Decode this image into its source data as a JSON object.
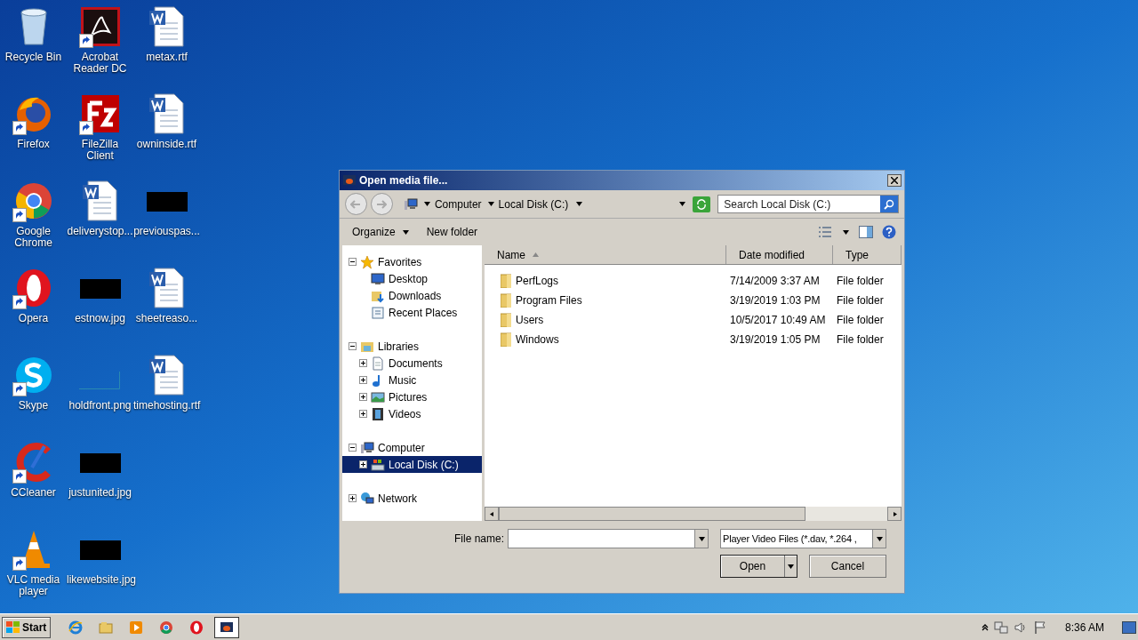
{
  "desktop": {
    "columns": [
      [
        {
          "label": "Recycle Bin",
          "kind": "recycle",
          "shortcut": false
        },
        {
          "label": "Firefox",
          "kind": "firefox",
          "shortcut": true
        },
        {
          "label": "Google Chrome",
          "kind": "chrome",
          "shortcut": true
        },
        {
          "label": "Opera",
          "kind": "opera",
          "shortcut": true
        },
        {
          "label": "Skype",
          "kind": "skype",
          "shortcut": true
        },
        {
          "label": "CCleaner",
          "kind": "ccleaner",
          "shortcut": true
        },
        {
          "label": "VLC media player",
          "kind": "vlc",
          "shortcut": true
        }
      ],
      [
        {
          "label": "Acrobat Reader DC",
          "kind": "acrobat",
          "shortcut": true
        },
        {
          "label": "FileZilla Client",
          "kind": "filezilla",
          "shortcut": true
        },
        {
          "label": "deliverystop...",
          "kind": "word",
          "shortcut": false
        },
        {
          "label": "estnow.jpg",
          "kind": "redacted",
          "shortcut": false
        },
        {
          "label": "holdfront.png",
          "kind": "blank-image",
          "shortcut": false
        },
        {
          "label": "justunited.jpg",
          "kind": "redacted",
          "shortcut": false
        },
        {
          "label": "likewebsite.jpg",
          "kind": "redacted",
          "shortcut": false
        }
      ],
      [
        {
          "label": "metax.rtf",
          "kind": "word",
          "shortcut": false
        },
        {
          "label": "owninside.rtf",
          "kind": "word",
          "shortcut": false
        },
        {
          "label": "previouspas...",
          "kind": "redacted",
          "shortcut": false
        },
        {
          "label": "sheetreaso...",
          "kind": "word",
          "shortcut": false
        },
        {
          "label": "timehosting.rtf",
          "kind": "word",
          "shortcut": false
        }
      ]
    ]
  },
  "dialog": {
    "title": "Open media file...",
    "breadcrumb": [
      "Computer",
      "Local Disk (C:)"
    ],
    "search": {
      "placeholder": "Search Local Disk (C:)"
    },
    "toolbar": [
      {
        "label": "Organize",
        "dropdown": true
      },
      {
        "label": "New folder",
        "dropdown": false
      }
    ],
    "tree": [
      {
        "label": "Favorites",
        "kind": "star",
        "expanded": true,
        "selected": false,
        "children": [
          {
            "label": "Desktop",
            "kind": "desktop",
            "selected": false
          },
          {
            "label": "Downloads",
            "kind": "downloads",
            "selected": false
          },
          {
            "label": "Recent Places",
            "kind": "recent",
            "selected": false
          }
        ]
      },
      {
        "label": "Libraries",
        "kind": "libraries",
        "expanded": true,
        "selected": false,
        "children": [
          {
            "label": "Documents",
            "kind": "documents",
            "expanded": false,
            "selected": false
          },
          {
            "label": "Music",
            "kind": "music",
            "expanded": false,
            "selected": false
          },
          {
            "label": "Pictures",
            "kind": "pictures",
            "expanded": false,
            "selected": false
          },
          {
            "label": "Videos",
            "kind": "videos",
            "expanded": false,
            "selected": false
          }
        ]
      },
      {
        "label": "Computer",
        "kind": "computer",
        "expanded": true,
        "selected": false,
        "children": [
          {
            "label": "Local Disk (C:)",
            "kind": "disk",
            "expanded": false,
            "selected": true
          }
        ]
      },
      {
        "label": "Network",
        "kind": "network",
        "expanded": false,
        "selected": false
      }
    ],
    "columns": [
      {
        "label": "Name",
        "sorted": true
      },
      {
        "label": "Date modified",
        "sorted": false
      },
      {
        "label": "Type",
        "sorted": false
      }
    ],
    "rows": [
      {
        "name": "PerfLogs",
        "date": "7/14/2009 3:37 AM",
        "type": "File folder"
      },
      {
        "name": "Program Files",
        "date": "3/19/2019 1:03 PM",
        "type": "File folder"
      },
      {
        "name": "Users",
        "date": "10/5/2017 10:49 AM",
        "type": "File folder"
      },
      {
        "name": "Windows",
        "date": "3/19/2019 1:05 PM",
        "type": "File folder"
      }
    ],
    "file_name": {
      "label": "File name:"
    },
    "filter": "Player Video Files (*.dav, *.264 ,",
    "buttons": [
      {
        "label": "Open",
        "split": true
      },
      {
        "label": "Cancel",
        "split": false
      }
    ]
  },
  "taskbar": {
    "start": "Start",
    "apps": [
      {
        "kind": "ie",
        "active": false
      },
      {
        "kind": "explorer",
        "active": false
      },
      {
        "kind": "media",
        "active": false
      },
      {
        "kind": "chrome",
        "active": false
      },
      {
        "kind": "opera",
        "active": false
      },
      {
        "kind": "player",
        "active": true
      }
    ],
    "clock": "8:36 AM"
  }
}
